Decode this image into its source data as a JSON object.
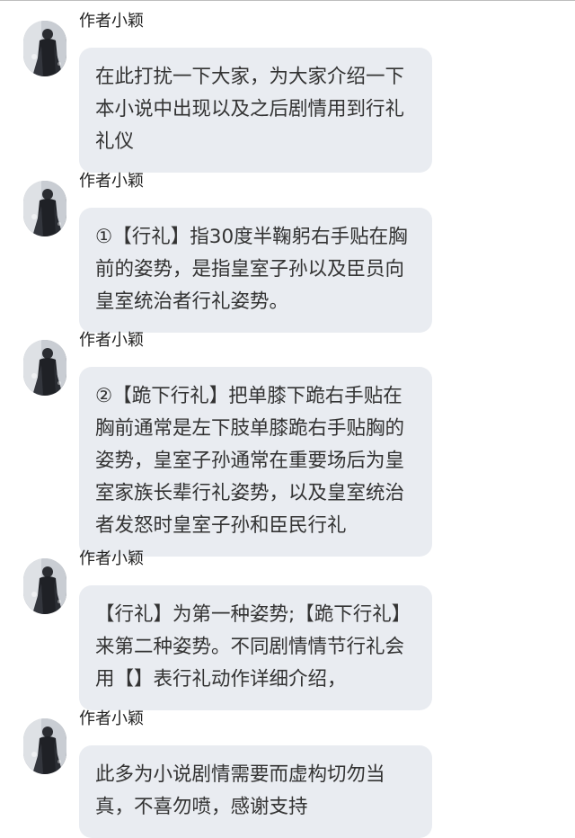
{
  "messages": [
    {
      "sender": "作者小颖",
      "text": "在此打扰一下大家，为大家介绍一下\n本小说中出现以及之后剧情用到行礼\n礼仪"
    },
    {
      "sender": "作者小颖",
      "text": "①【行礼】指30度半鞠躬右手贴在胸\n前的姿势，是指皇室子孙以及臣员向\n皇室统治者行礼姿势。"
    },
    {
      "sender": "作者小颖",
      "text": "②【跪下行礼】把单膝下跪右手贴在\n胸前通常是左下肢单膝跪右手贴胸的\n姿势，皇室子孙通常在重要场后为皇\n室家族长辈行礼姿势，以及皇室统治\n者发怒时皇室子孙和臣民行礼"
    },
    {
      "sender": "作者小颖",
      "text": "【行礼】为第一种姿势;【跪下行礼】\n来第二种姿势。不同剧情情节行礼会\n用【】表行礼动作详细介绍，"
    },
    {
      "sender": "作者小颖",
      "text": "此多为小说剧情需要而虚构切勿当\n真，不喜勿喷，感谢支持"
    }
  ],
  "avatar_icon": "user-avatar-photo"
}
